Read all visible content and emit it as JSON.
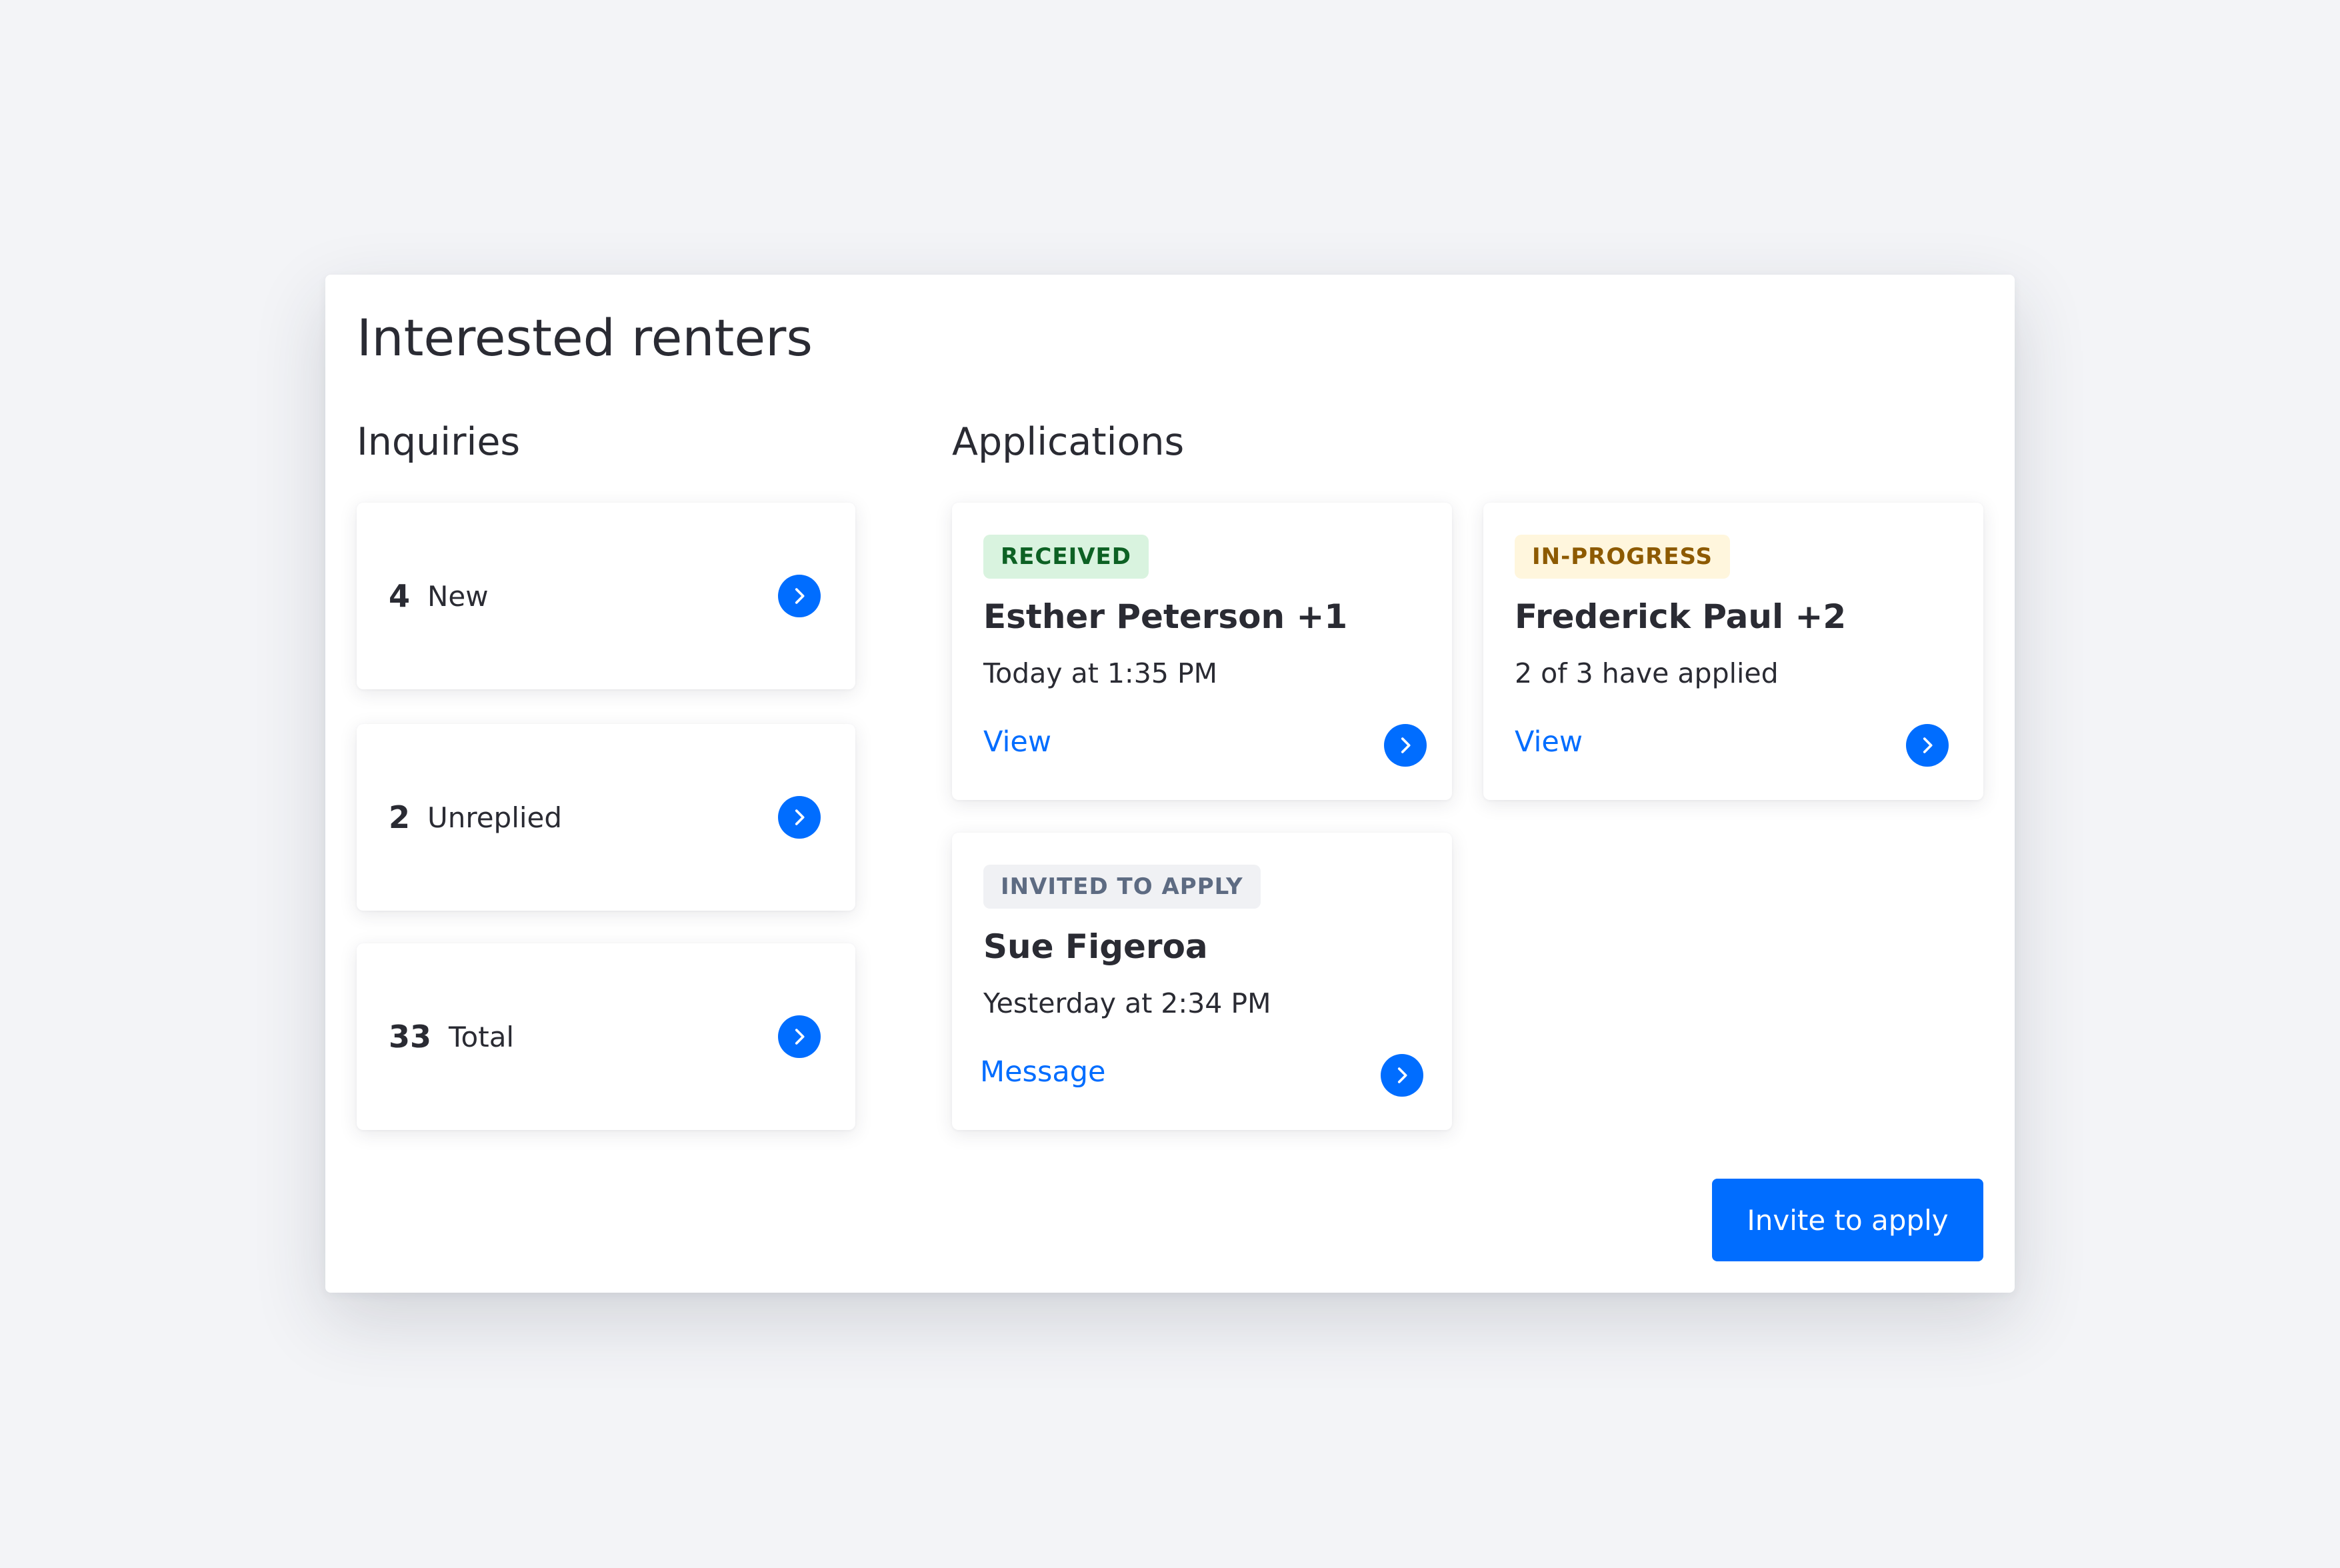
{
  "modal": {
    "title": "Interested renters"
  },
  "inquiries": {
    "heading": "Inquiries",
    "items": [
      {
        "count": "4",
        "label": "New",
        "icon": "chevron-right-circle-icon"
      },
      {
        "count": "2",
        "label": "Unreplied",
        "icon": "chevron-right-circle-icon"
      },
      {
        "count": "33",
        "label": "Total",
        "icon": "chevron-right-circle-icon"
      }
    ]
  },
  "applications": {
    "heading": "Applications",
    "items": [
      {
        "status": "RECEIVED",
        "status_color": "#0d6124",
        "status_bg": "#d9f3df",
        "name": "Esther Peterson +1",
        "detail": "Today at 1:35 PM",
        "action": "View",
        "icon": "chevron-right-circle-icon"
      },
      {
        "status": "IN-PROGRESS",
        "status_color": "#8d5a00",
        "status_bg": "#fff6dd",
        "name": "Frederick Paul +2",
        "detail": "2 of 3 have applied",
        "action": "View",
        "icon": "chevron-right-circle-icon"
      },
      {
        "status": "INVITED TO APPLY",
        "status_color": "#5d6b82",
        "status_bg": "#f0f1f4",
        "name": "Sue Figeroa",
        "detail": "Yesterday at 2:34 PM",
        "action": "Message",
        "icon": "chevron-right-circle-icon"
      }
    ]
  },
  "footer": {
    "primary_button": "Invite to apply"
  },
  "colors": {
    "accent": "#006dff",
    "text": "#2a2b33",
    "background": "#f3f4f7"
  }
}
